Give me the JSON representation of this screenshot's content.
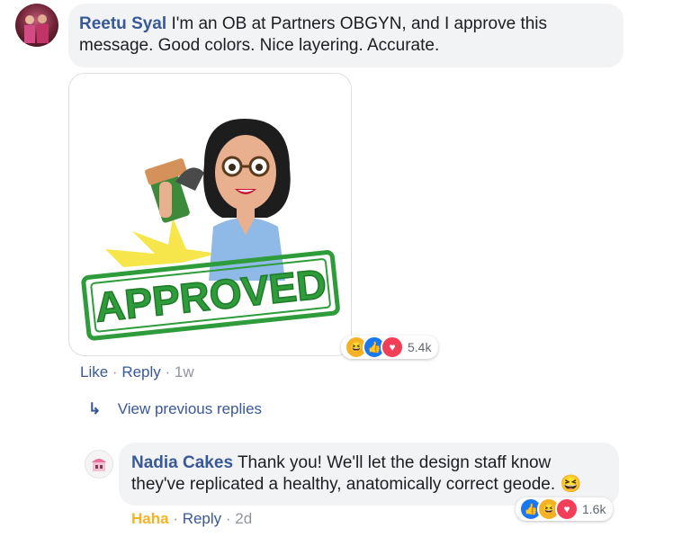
{
  "comment": {
    "author": "Reetu Syal",
    "text": "I'm an OB at Partners OBGYN, and I approve this message. Good colors. Nice layering. Accurate.",
    "reactions": {
      "icons": [
        "haha-icon",
        "like-icon",
        "love-icon"
      ],
      "count": "5.4k"
    },
    "actions": {
      "like": "Like",
      "reply": "Reply",
      "time": "1w"
    },
    "sticker_text": "APPROVED"
  },
  "thread": {
    "view_previous": "View previous replies"
  },
  "reply": {
    "author": "Nadia Cakes",
    "text": "Thank you! We'll let the design staff know they've replicated a healthy, anatomically correct geode.",
    "emoji": "😆",
    "reactions": {
      "icons": [
        "like-icon",
        "haha-icon",
        "love-icon"
      ],
      "count": "1.6k"
    },
    "actions": {
      "haha": "Haha",
      "reply": "Reply",
      "time": "2d"
    }
  },
  "colors": {
    "link": "#385898",
    "bubble": "#f2f3f5",
    "haha": "#f7b125",
    "like": "#1877f2",
    "love": "#f33e58",
    "approved_green": "#2e9c3a"
  }
}
